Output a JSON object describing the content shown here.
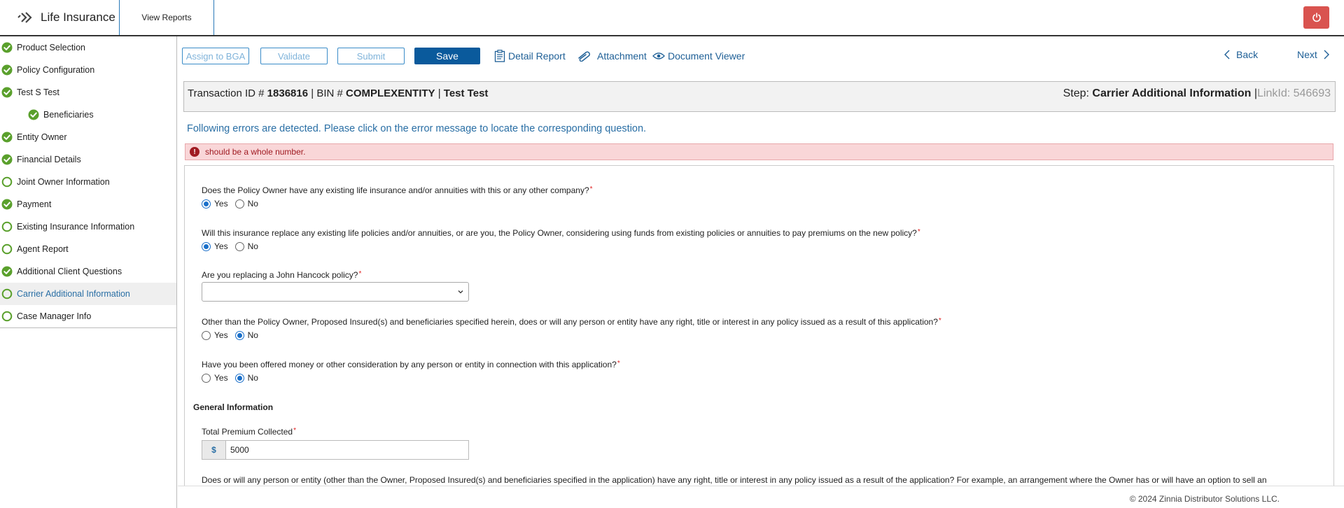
{
  "header": {
    "app_title": "Life Insurance",
    "nav_tab": "View Reports"
  },
  "sidebar": {
    "items": [
      {
        "label": "Product Selection",
        "status": "complete"
      },
      {
        "label": "Policy Configuration",
        "status": "complete"
      },
      {
        "label": "Test S Test",
        "status": "complete"
      },
      {
        "label": "Beneficiaries",
        "status": "complete"
      },
      {
        "label": "Entity Owner",
        "status": "complete"
      },
      {
        "label": "Financial Details",
        "status": "complete"
      },
      {
        "label": "Joint Owner Information",
        "status": "incomplete"
      },
      {
        "label": "Payment",
        "status": "complete"
      },
      {
        "label": "Existing Insurance Information",
        "status": "incomplete"
      },
      {
        "label": "Agent Report",
        "status": "incomplete"
      },
      {
        "label": "Additional Client Questions",
        "status": "complete"
      },
      {
        "label": "Carrier Additional Information",
        "status": "incomplete"
      },
      {
        "label": "Case Manager Info",
        "status": "incomplete"
      }
    ]
  },
  "toolbar": {
    "assign_label": "Assign to BGA",
    "validate_label": "Validate",
    "submit_label": "Submit",
    "save_label": "Save",
    "detail_report_label": "Detail Report",
    "attachment_label": "Attachment",
    "document_viewer_label": "Document Viewer",
    "back_label": "Back",
    "next_label": "Next"
  },
  "transaction": {
    "id_prefix": "Transaction ID #",
    "id_value": "1836816",
    "bin_prefix": "| BIN #",
    "bin_value": "COMPLEXENTITY",
    "sep": "|",
    "name": "Test Test",
    "step_prefix": "Step:",
    "step_value": "Carrier Additional Information",
    "link_sep": "|",
    "link_label": "LinkId: 546693"
  },
  "errors": {
    "heading": "Following errors are detected. Please click on the error message to locate the corresponding question.",
    "message": "should be a whole number."
  },
  "form": {
    "q1": {
      "text": "Does the Policy Owner have any existing life insurance and/or annuities with this or any other company?",
      "selected": "Yes"
    },
    "q2": {
      "text": "Will this insurance replace any existing life policies and/or annuities, or are you, the Policy Owner, considering using funds from existing policies or annuities to pay premiums on the new policy?",
      "selected": "Yes"
    },
    "q3": {
      "text": "Are you replacing a John Hancock policy?",
      "value": ""
    },
    "q4": {
      "text": "Other than the Policy Owner, Proposed Insured(s) and beneficiaries specified herein, does or will any person or entity have any right, title or interest in any policy issued as a result of this application?",
      "selected": "No"
    },
    "q5": {
      "text": "Have you been offered money or other consideration by any person or entity in connection with this application?",
      "selected": "No"
    },
    "yes_label": "Yes",
    "no_label": "No",
    "section_title": "General Information",
    "premium": {
      "label": "Total Premium Collected",
      "currency": "$",
      "value": "5000"
    },
    "q6": {
      "text": "Does or will any person or entity (other than the Owner, Proposed Insured(s) and beneficiaries specified in the application) have any right, title or interest in any policy issued as a result of the application? For example, an arrangement where the Owner has or will have an option to sell an"
    }
  },
  "footer": {
    "copyright": "© 2024 Zinnia Distributor Solutions LLC."
  },
  "colors": {
    "accent": "#0a5a9c",
    "complete": "#5aa02c",
    "error_bg": "#f9d6d8",
    "power": "#d9534f"
  }
}
